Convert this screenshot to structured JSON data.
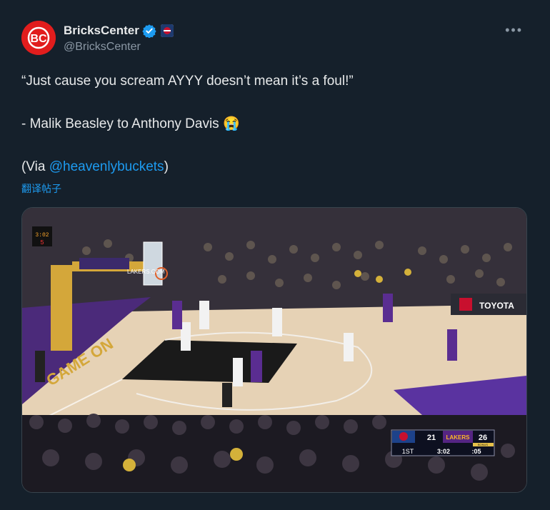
{
  "account": {
    "display_name": "BricksCenter",
    "handle": "@BricksCenter",
    "avatar_text": "BC",
    "verified_icon": "verified-badge-icon",
    "affiliation_icon": "affiliation-badge-icon"
  },
  "more_icon": "more-options-icon",
  "tweet": {
    "line1": "“Just cause you scream AYYY doesn’t mean it’s a foul!”",
    "line2": "- Malik Beasley to Anthony Davis 😭",
    "line3_prefix": "(Via ",
    "line3_mention": "@heavenlybuckets",
    "line3_suffix": ")"
  },
  "translate_label": "翻译帖子",
  "media": {
    "type": "video-frame",
    "scoreboard": {
      "team1_score": "21",
      "team2_score": "26",
      "team2_logo": "LAKERS",
      "bonus_label": "BONUS",
      "period": "1ST",
      "clock": "3:02",
      "shot_clock": ":05"
    },
    "ad_toyota": "TOYOTA",
    "ad_lakers": "LAKERS.COM",
    "shot_clock_display_top": "3:02",
    "shot_clock_display_bottom": "5"
  },
  "colors": {
    "background": "#15202b",
    "text": "#e7e9ea",
    "secondary": "#8b98a5",
    "link": "#1d9bf0",
    "avatar": "#e11d1d"
  }
}
